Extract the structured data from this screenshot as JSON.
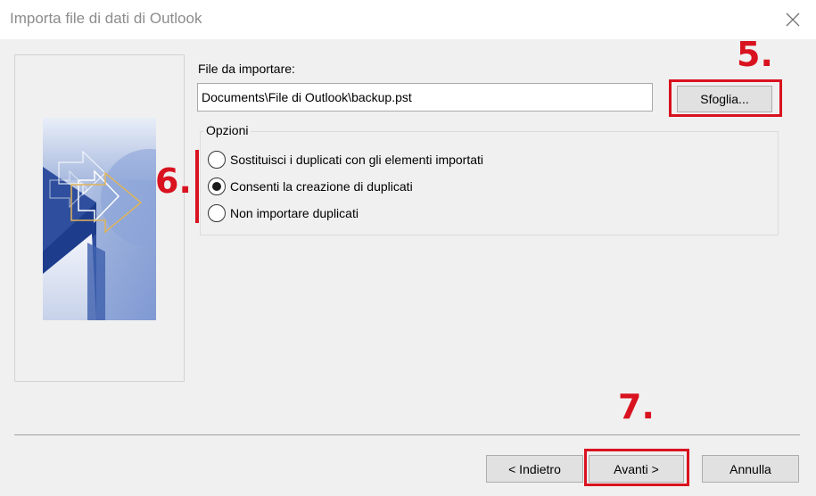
{
  "window": {
    "title": "Importa file di dati di Outlook",
    "close_icon": "close-icon"
  },
  "file": {
    "label": "File da importare:",
    "value": "Documents\\File di Outlook\\backup.pst",
    "browse_label": "Sfoglia..."
  },
  "options": {
    "legend": "Opzioni",
    "items": [
      {
        "label": "Sostituisci i duplicati con gli elementi importati",
        "selected": false
      },
      {
        "label": "Consenti la creazione di duplicati",
        "selected": true
      },
      {
        "label": "Non importare duplicati",
        "selected": false
      }
    ]
  },
  "annotations": {
    "step5": "5.",
    "step6": "6.",
    "step7": "7.",
    "highlight_color": "#d9121f"
  },
  "footer": {
    "back_label": "< Indietro",
    "next_label": "Avanti >",
    "cancel_label": "Annulla"
  }
}
